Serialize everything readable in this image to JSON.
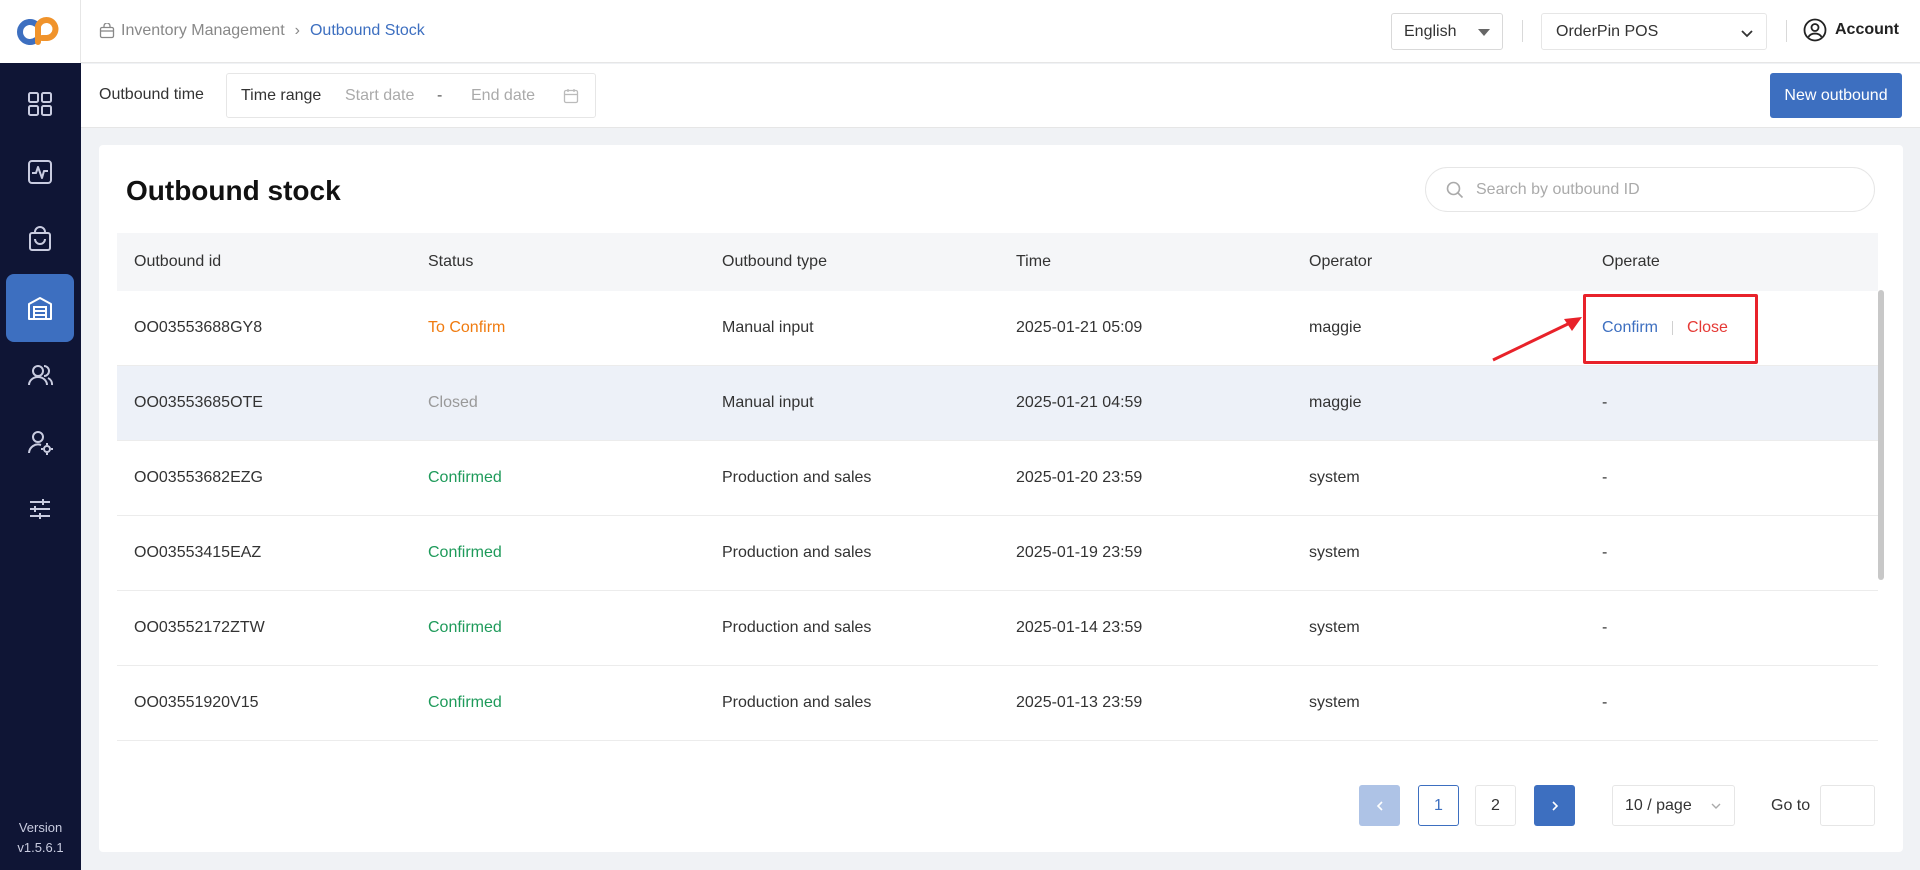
{
  "sidebar": {
    "logo": "orderpin-logo",
    "items": [
      {
        "icon": "dashboard-grid-icon",
        "active": false
      },
      {
        "icon": "activity-chart-icon",
        "active": false
      },
      {
        "icon": "shopping-bag-icon",
        "active": false
      },
      {
        "icon": "warehouse-icon",
        "active": true
      },
      {
        "icon": "users-icon",
        "active": false
      },
      {
        "icon": "user-settings-icon",
        "active": false
      },
      {
        "icon": "sliders-icon",
        "active": false
      }
    ],
    "version_label": "Version",
    "version_value": "v1.5.6.1"
  },
  "header": {
    "breadcrumb_parent": "Inventory Management",
    "breadcrumb_current": "Outbound Stock",
    "language": "English",
    "store": "OrderPin POS",
    "account": "Account"
  },
  "filters": {
    "label": "Outbound time",
    "range_label": "Time range",
    "start_placeholder": "Start date",
    "separator": "-",
    "end_placeholder": "End date",
    "new_button": "New outbound"
  },
  "card": {
    "title": "Outbound stock",
    "search_placeholder": "Search by outbound ID"
  },
  "table": {
    "columns": [
      "Outbound id",
      "Status",
      "Outbound type",
      "Time",
      "Operator",
      "Operate"
    ],
    "rows": [
      {
        "id": "OO03553688GY8",
        "status": "To Confirm",
        "type": "Manual input",
        "time": "2025-01-21 05:09",
        "operator": "maggie",
        "confirm": "Confirm",
        "close": "Close"
      },
      {
        "id": "OO03553685OTE",
        "status": "Closed",
        "type": "Manual input",
        "time": "2025-01-21 04:59",
        "operator": "maggie",
        "operate": "-"
      },
      {
        "id": "OO03553682EZG",
        "status": "Confirmed",
        "type": "Production and sales",
        "time": "2025-01-20 23:59",
        "operator": "system",
        "operate": "-"
      },
      {
        "id": "OO03553415EAZ",
        "status": "Confirmed",
        "type": "Production and sales",
        "time": "2025-01-19 23:59",
        "operator": "system",
        "operate": "-"
      },
      {
        "id": "OO03552172ZTW",
        "status": "Confirmed",
        "type": "Production and sales",
        "time": "2025-01-14 23:59",
        "operator": "system",
        "operate": "-"
      },
      {
        "id": "OO03551920V15",
        "status": "Confirmed",
        "type": "Production and sales",
        "time": "2025-01-13 23:59",
        "operator": "system",
        "operate": "-"
      }
    ]
  },
  "pagination": {
    "pages": [
      "1",
      "2"
    ],
    "current": "1",
    "per_page": "10 / page",
    "goto_label": "Go to"
  },
  "colors": {
    "primary": "#3d6fc0",
    "sidebar_bg": "#0f1535",
    "to_confirm": "#f07b0f",
    "confirmed": "#1e9a5a",
    "closed": "#999999",
    "close_action": "#e53935",
    "annotation": "#e8222a"
  }
}
